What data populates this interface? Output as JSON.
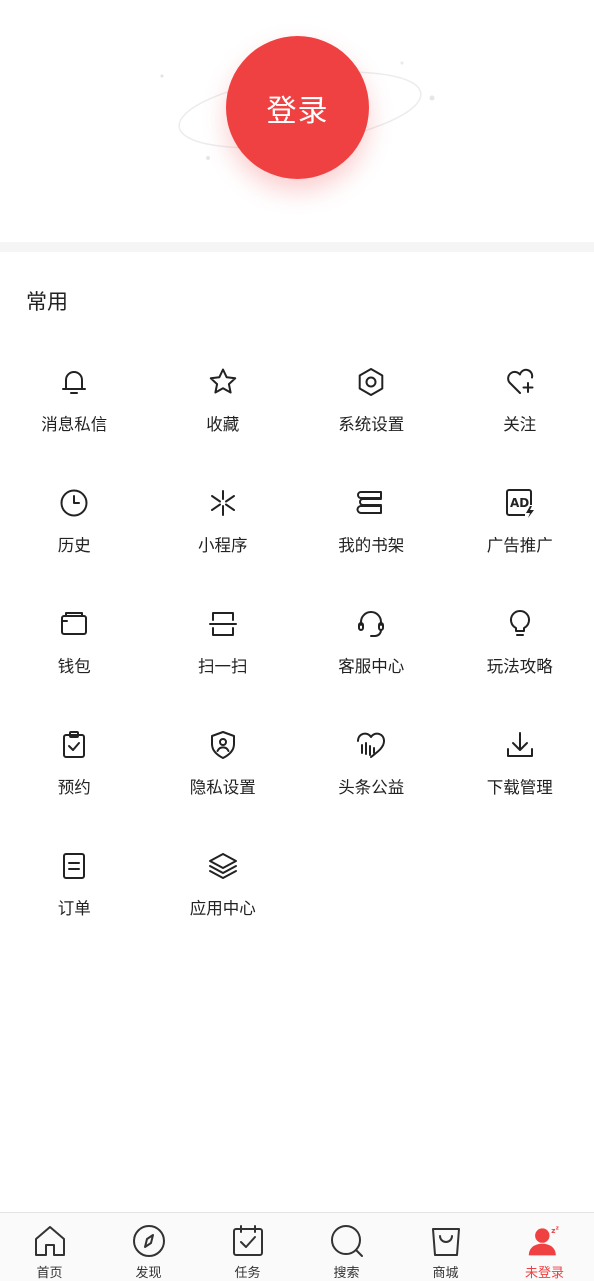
{
  "header": {
    "login_label": "登录"
  },
  "section": {
    "title": "常用"
  },
  "grid": [
    {
      "label": "消息私信",
      "icon": "bell-icon"
    },
    {
      "label": "收藏",
      "icon": "star-icon"
    },
    {
      "label": "系统设置",
      "icon": "gear-icon"
    },
    {
      "label": "关注",
      "icon": "heart-plus-icon"
    },
    {
      "label": "历史",
      "icon": "clock-icon"
    },
    {
      "label": "小程序",
      "icon": "mini-program-icon"
    },
    {
      "label": "我的书架",
      "icon": "bookshelf-icon"
    },
    {
      "label": "广告推广",
      "icon": "ad-icon"
    },
    {
      "label": "钱包",
      "icon": "wallet-icon"
    },
    {
      "label": "扫一扫",
      "icon": "scan-icon"
    },
    {
      "label": "客服中心",
      "icon": "headset-icon"
    },
    {
      "label": "玩法攻略",
      "icon": "lightbulb-icon"
    },
    {
      "label": "预约",
      "icon": "clipboard-check-icon"
    },
    {
      "label": "隐私设置",
      "icon": "shield-user-icon"
    },
    {
      "label": "头条公益",
      "icon": "charity-heart-icon"
    },
    {
      "label": "下载管理",
      "icon": "download-icon"
    },
    {
      "label": "订单",
      "icon": "order-icon"
    },
    {
      "label": "应用中心",
      "icon": "layers-icon"
    }
  ],
  "tabbar": [
    {
      "label": "首页",
      "icon": "home-icon"
    },
    {
      "label": "发现",
      "icon": "compass-icon"
    },
    {
      "label": "任务",
      "icon": "task-calendar-icon"
    },
    {
      "label": "搜索",
      "icon": "search-icon"
    },
    {
      "label": "商城",
      "icon": "shopping-bag-icon"
    },
    {
      "label": "未登录",
      "icon": "user-sleep-icon",
      "active": true
    }
  ],
  "colors": {
    "accent": "#f04142",
    "text": "#222222",
    "divider": "#f5f5f5"
  }
}
